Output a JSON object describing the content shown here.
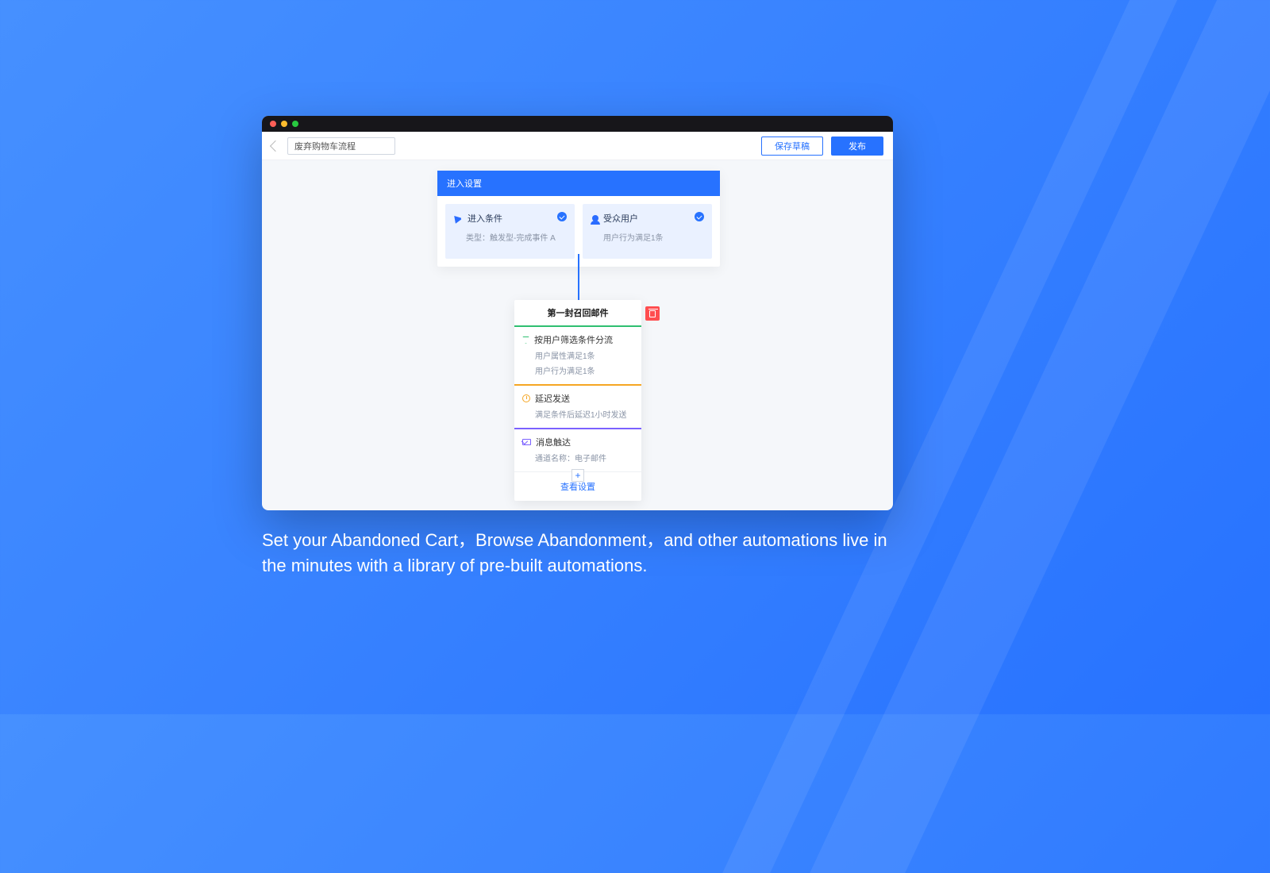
{
  "topbar": {
    "flow_name": "废弃购物车流程",
    "save_draft": "保存草稿",
    "publish": "发布"
  },
  "entry": {
    "header": "进入设置",
    "condition": {
      "title": "进入条件",
      "subtitle": "类型：触发型-完成事件 A"
    },
    "audience": {
      "title": "受众用户",
      "subtitle": "用户行为满足1条"
    }
  },
  "step": {
    "title": "第一封召回邮件",
    "filter": {
      "title": "按用户筛选条件分流",
      "line1": "用户属性满足1条",
      "line2": "用户行为满足1条"
    },
    "delay": {
      "title": "延迟发送",
      "line1": "满足条件后延迟1小时发送"
    },
    "message": {
      "title": "消息触达",
      "line1": "通道名称：电子邮件"
    },
    "view": "查看设置"
  },
  "caption": "Set your Abandoned Cart，Browse Abandonment，and other automations live in the minutes with a library of pre-built automations."
}
